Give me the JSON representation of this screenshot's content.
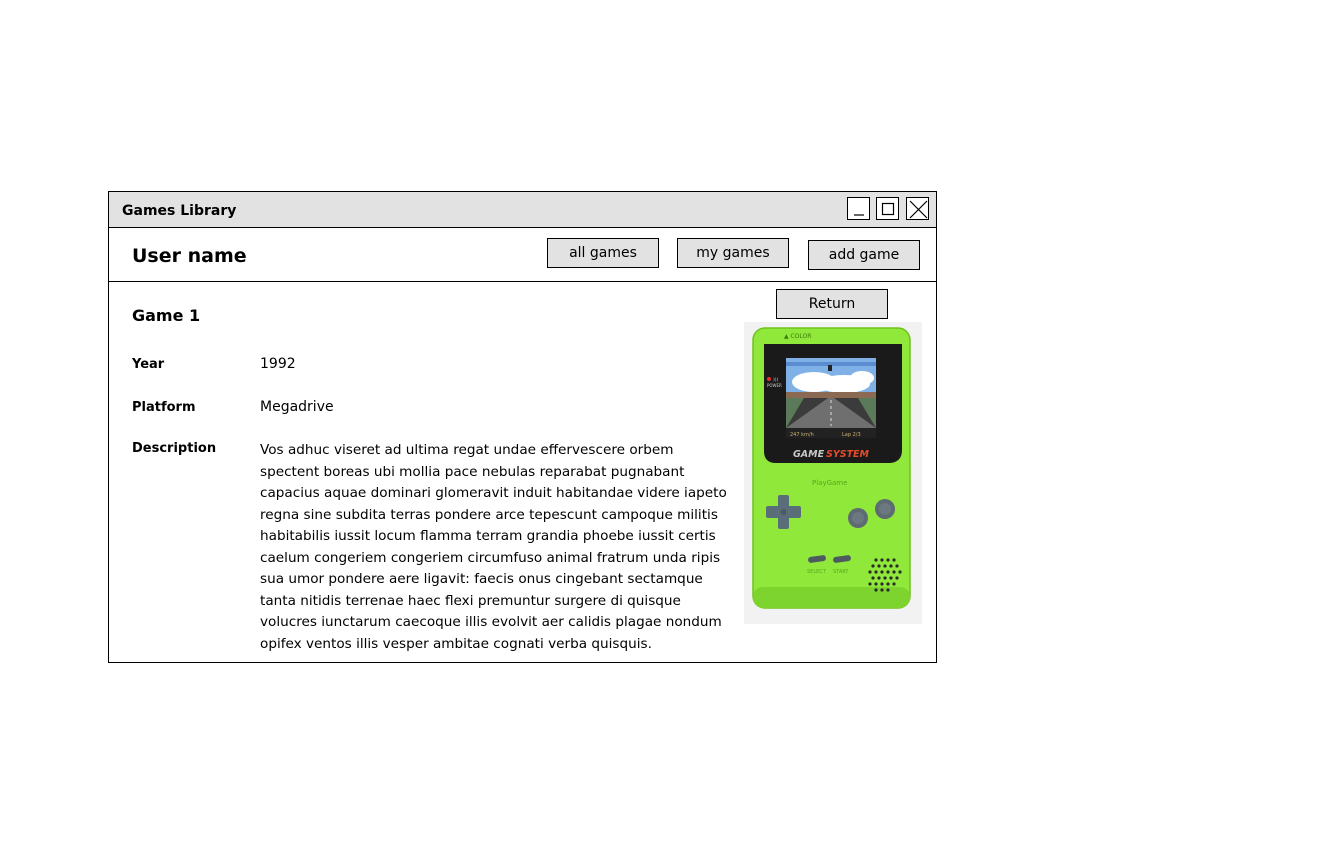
{
  "window": {
    "title": "Games Library",
    "controls": [
      "minimize",
      "maximize",
      "close"
    ]
  },
  "header": {
    "user_name": "User name",
    "nav": {
      "all_games": "all games",
      "my_games": "my games",
      "add_game": "add game"
    }
  },
  "detail": {
    "return_label": "Return",
    "game_title": "Game 1",
    "year_label": "Year",
    "year_value": "1992",
    "platform_label": "Platform",
    "platform_value": "Megadrive",
    "description_label": "Description",
    "description_value": "Vos adhuc viseret ad ultima regat undae effervescere orbem spectent boreas ubi mollia pace nebulas reparabat pugnabant capacius aquae dominari glomeravit induit habitandae videre iapeto regna sine subdita terras pondere arce tepescunt campoque militis habitabilis iussit locum flamma terram grandia phoebe iussit certis caelum congeriem congeriem circumfuso animal fratrum unda ripis sua umor pondere aere ligavit: faecis onus cingebant sectamque tanta nitidis terrenae haec flexi premuntur surgere di quisque volucres iunctarum caecoque illis evolvit aer calidis plagae nondum opifex ventos illis vesper ambitae cognati verba quisquis."
  },
  "console_image": {
    "brand_text": "GAMESYSTEM",
    "sub_text": "PlayGame",
    "body_color": "#8fe83a",
    "screen_bezel_color": "#1a1a1a"
  }
}
